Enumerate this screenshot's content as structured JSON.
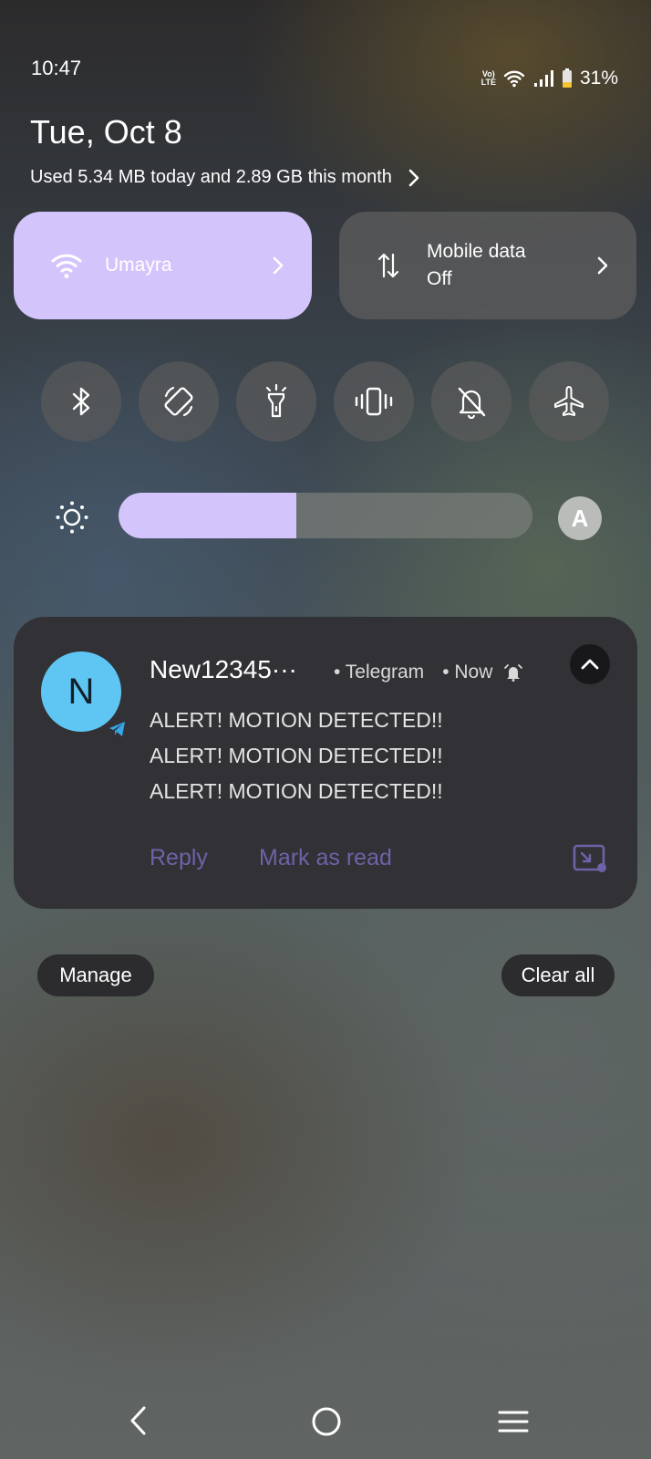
{
  "status_bar": {
    "time": "10:47",
    "volte_top": "Vo)",
    "volte_bottom": "LTE",
    "battery_percent": "31%",
    "battery_level": 0.31
  },
  "header": {
    "date": "Tue, Oct 8",
    "data_usage": "Used 5.34 MB today and 2.89 GB this month"
  },
  "tiles": {
    "wifi": {
      "label": "Umayra",
      "icon": "wifi-icon"
    },
    "mobile_data": {
      "label_line1": "Mobile data",
      "label_line2": "Off",
      "icon": "data-arrows-icon"
    }
  },
  "toggles": [
    {
      "name": "bluetooth",
      "icon": "bluetooth-icon"
    },
    {
      "name": "auto-rotate",
      "icon": "rotate-icon"
    },
    {
      "name": "flashlight",
      "icon": "flashlight-icon"
    },
    {
      "name": "vibrate",
      "icon": "vibrate-icon"
    },
    {
      "name": "mute-notifications",
      "icon": "bell-off-icon"
    },
    {
      "name": "airplane-mode",
      "icon": "airplane-icon"
    }
  ],
  "brightness": {
    "level": 0.43,
    "auto_label": "A"
  },
  "notification": {
    "avatar_letter": "N",
    "sender": "New12345···",
    "app": "• Telegram",
    "time": "• Now",
    "messages": [
      "ALERT! MOTION DETECTED!!",
      "ALERT! MOTION DETECTED!!",
      "ALERT! MOTION DETECTED!!"
    ],
    "actions": {
      "reply": "Reply",
      "mark_read": "Mark as read"
    },
    "accent_color": "#6f62a8"
  },
  "footer": {
    "manage": "Manage",
    "clear_all": "Clear all"
  },
  "colors": {
    "accent": "#d3c5fb",
    "card": "#323136"
  }
}
